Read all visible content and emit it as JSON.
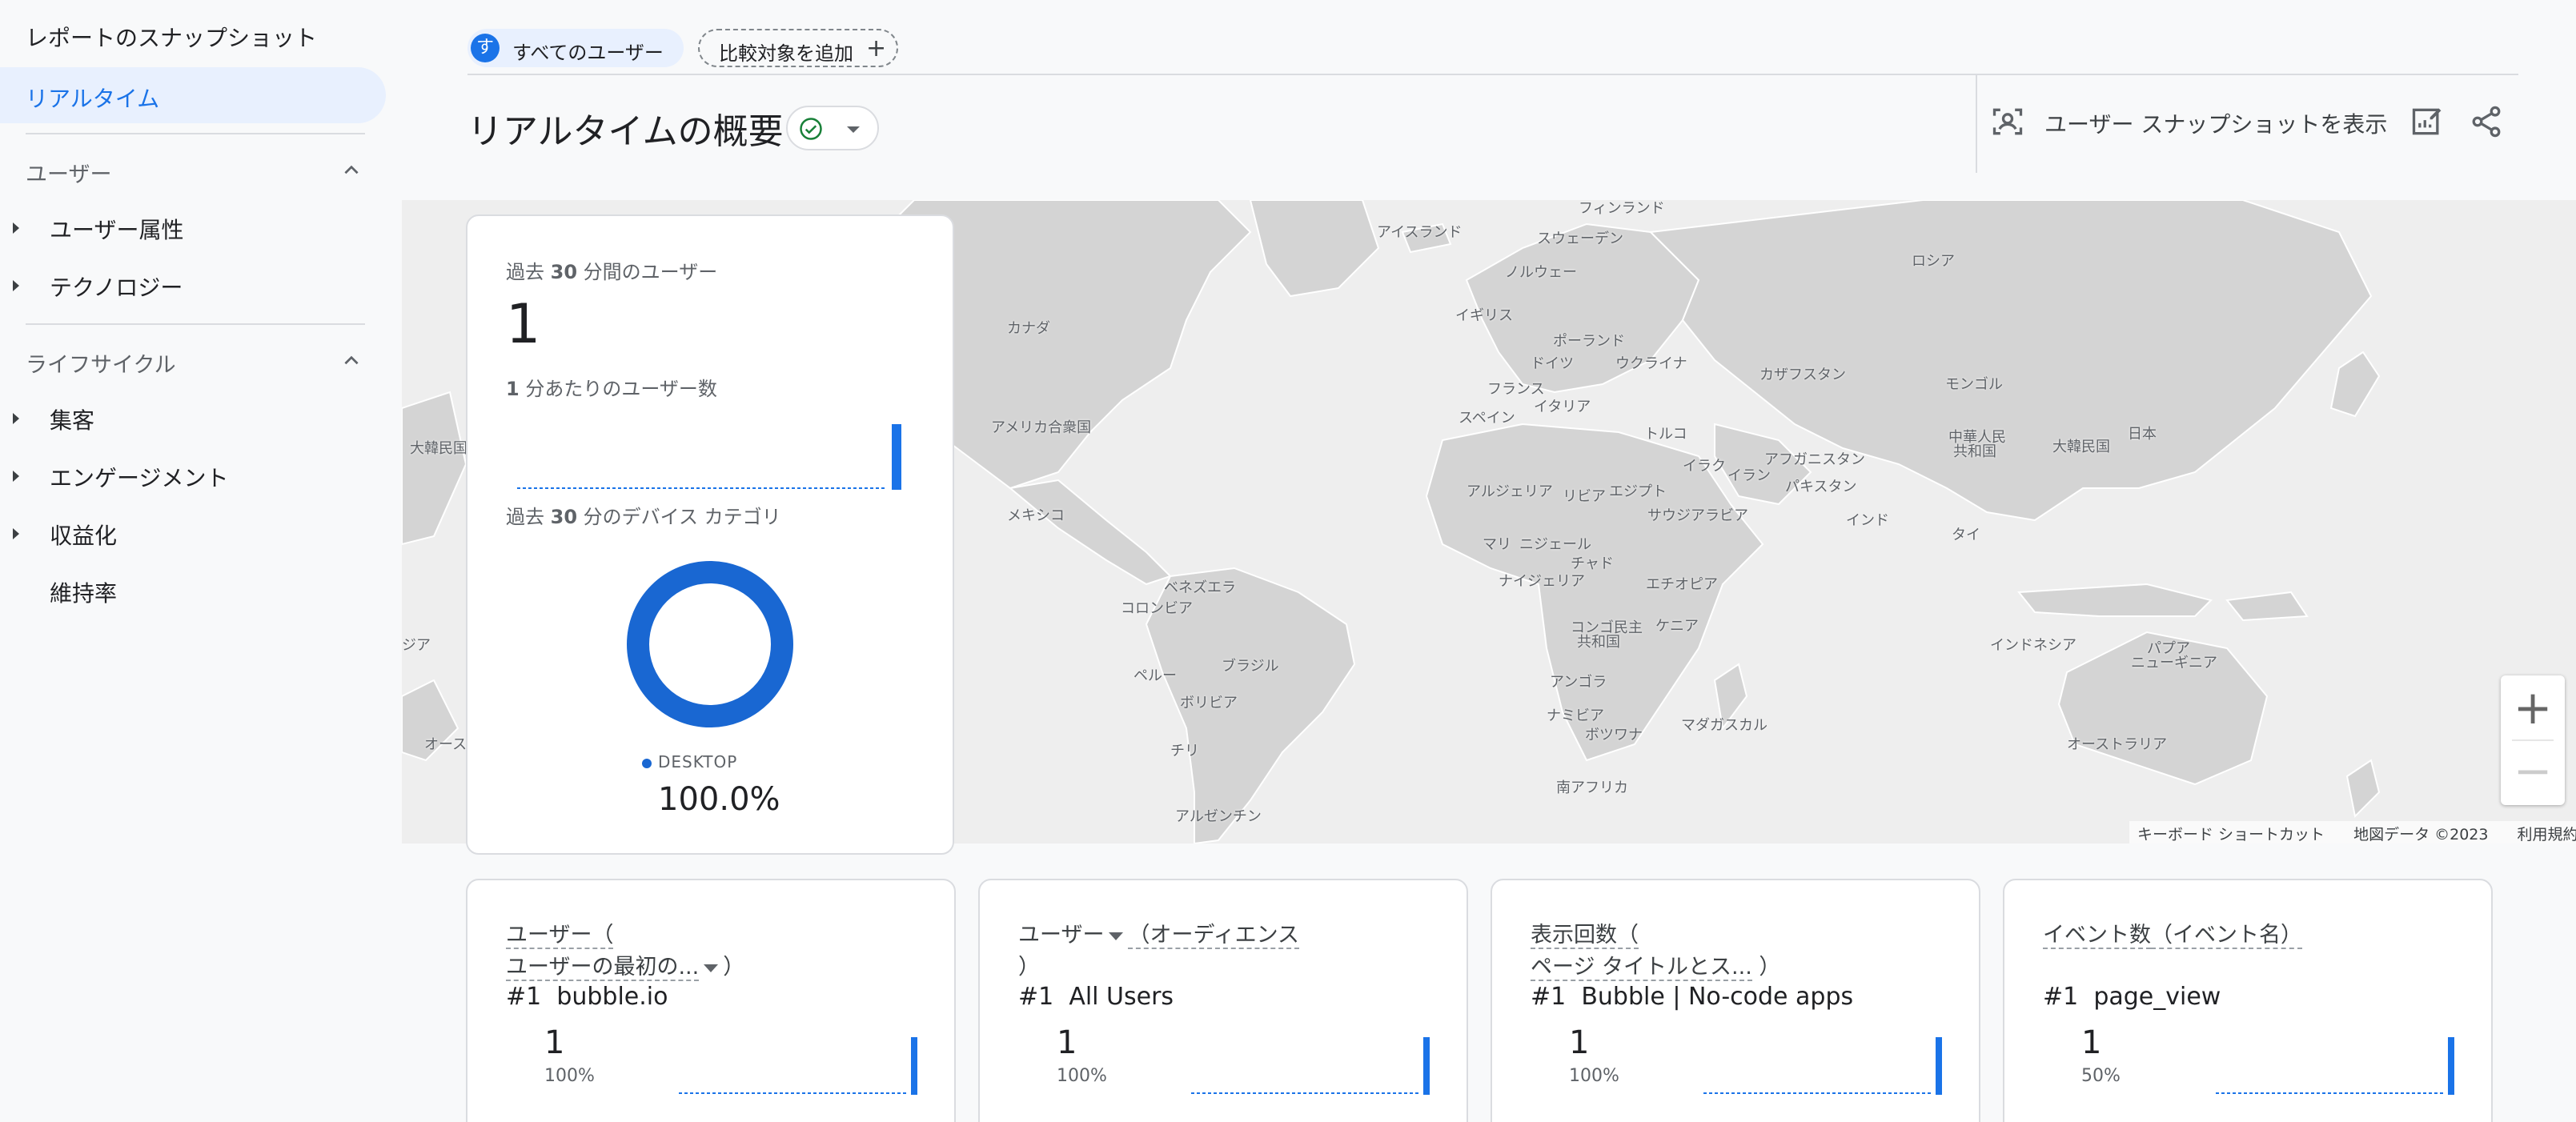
{
  "sidebar": {
    "snapshot": "レポートのスナップショット",
    "realtime": "リアルタイム",
    "users_section": "ユーザー",
    "user_attributes": "ユーザー属性",
    "technology": "テクノロジー",
    "lifecycle_section": "ライフサイクル",
    "acquisition": "集客",
    "engagement": "エンゲージメント",
    "monetization": "収益化",
    "retention": "維持率"
  },
  "topbar": {
    "avatar_letter": "す",
    "all_users": "すべてのユーザー",
    "add_compare": "比較対象を追加"
  },
  "header": {
    "title": "リアルタイムの概要",
    "snapshot_button": "ユーザー スナップショットを表示"
  },
  "map": {
    "labels": {
      "iceland": "アイスランド",
      "finland": "フィンランド",
      "sweden": "スウェーデン",
      "norway": "ノルウェー",
      "russia": "ロシア",
      "uk": "イギリス",
      "poland": "ポーランド",
      "germany": "ドイツ",
      "ukraine": "ウクライナ",
      "france": "フランス",
      "italy": "イタリア",
      "spain": "スペイン",
      "kazakhstan": "カザフスタン",
      "mongolia": "モンゴル",
      "china1": "中華人民",
      "china2": "共和国",
      "korea": "大韓民国",
      "japan": "日本",
      "turkey": "トルコ",
      "iraq": "イラク",
      "iran": "イラン",
      "afghanistan": "アフガニスタン",
      "pakistan": "パキスタン",
      "india": "インド",
      "thailand": "タイ",
      "saudi": "サウジアラビア",
      "algeria": "アルジェリア",
      "libya": "リビア",
      "egypt": "エジプト",
      "mali": "マリ",
      "niger": "ニジェール",
      "chad": "チャド",
      "nigeria": "ナイジェリア",
      "ethiopia": "エチオピア",
      "drc1": "コンゴ民主",
      "drc2": "共和国",
      "kenya": "ケニア",
      "angola": "アンゴラ",
      "namibia": "ナミビア",
      "botswana": "ボツワナ",
      "madagascar": "マダガスカル",
      "south_africa": "南アフリカ",
      "indonesia": "インドネシア",
      "png1": "パプア",
      "png2": "ニューギニア",
      "australia": "オーストラリア",
      "canada": "カナダ",
      "usa": "アメリカ合衆国",
      "mexico": "メキシコ",
      "venezuela": "ベネズエラ",
      "colombia": "コロンビア",
      "peru": "ペルー",
      "brazil": "ブラジル",
      "bolivia": "ボリビア",
      "chile": "チリ",
      "argentina": "アルゼンチン",
      "korea_left": "大韓民国",
      "asia_left": "ジア",
      "aus_left": "オース"
    },
    "footer_shortcuts": "キーボード ショートカット",
    "footer_data": "地図データ ©2023",
    "footer_terms": "利用規約"
  },
  "realtime_card": {
    "users_label_pre": "過去 ",
    "users_label_num": "30",
    "users_label_post": " 分間のユーザー",
    "users_value": "1",
    "per_minute_num": "1",
    "per_minute_post": " 分あたりのユーザー数",
    "device_label_pre": "過去 ",
    "device_label_num": "30",
    "device_label_post": " 分のデバイス カテゴリ",
    "legend": "DESKTOP",
    "percent": "100.0%",
    "desktop_share": 1.0
  },
  "cards": [
    {
      "h1": "ユーザー（",
      "h2": "ユーザーの最初の...",
      "h2_tail": "）",
      "rank": "#1",
      "name": "bubble.io",
      "value": "1",
      "percent": "100%"
    },
    {
      "h1": "ユーザー",
      "h1b": "（オーディエンス",
      "h2": "）",
      "rank": "#1",
      "name": "All Users",
      "value": "1",
      "percent": "100%"
    },
    {
      "h1": "表示回数（",
      "h2": "ページ タイトルとス...",
      "h2_tail": "）",
      "rank": "#1",
      "name": "Bubble | No-code apps",
      "value": "1",
      "percent": "100%"
    },
    {
      "h1": "イベント数",
      "h1b": "（イベント名）",
      "rank": "#1",
      "name": "page_view",
      "value": "1",
      "percent": "50%"
    }
  ]
}
